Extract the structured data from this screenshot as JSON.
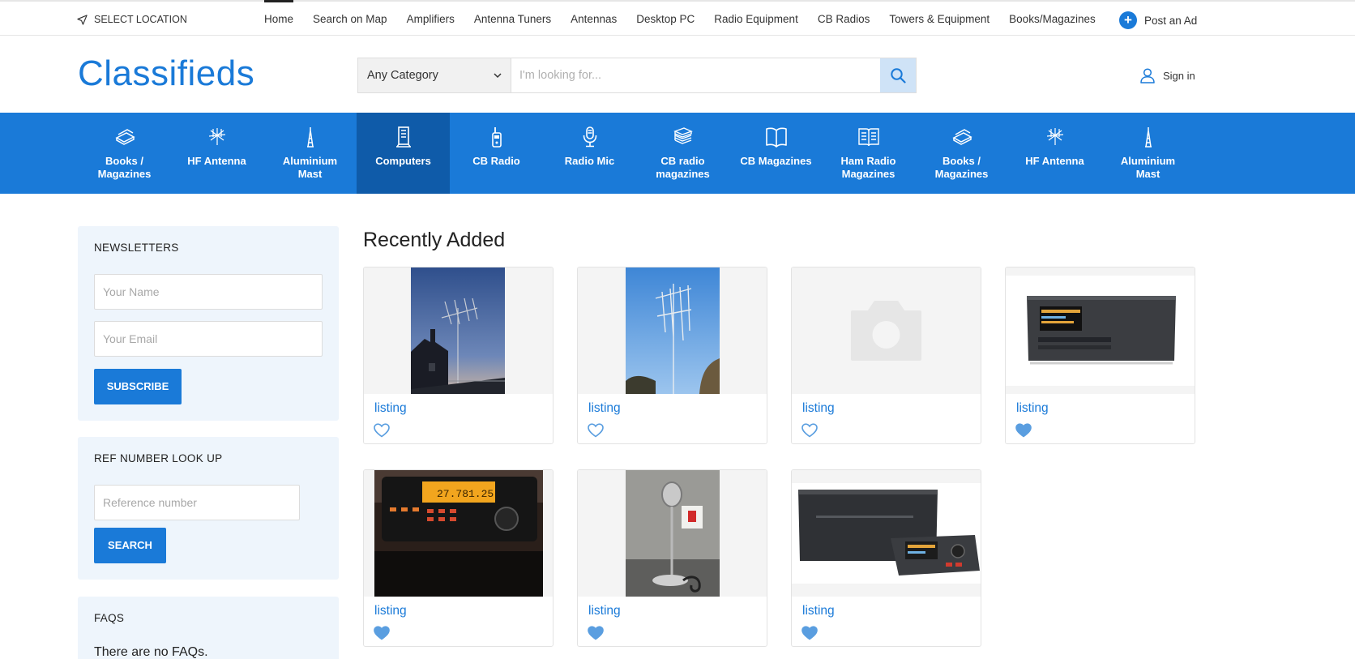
{
  "topbar": {
    "location_label": "SELECT LOCATION",
    "nav": [
      {
        "label": "Home",
        "active": true
      },
      {
        "label": "Search on Map",
        "active": false
      },
      {
        "label": "Amplifiers",
        "active": false
      },
      {
        "label": "Antenna Tuners",
        "active": false
      },
      {
        "label": "Antennas",
        "active": false
      },
      {
        "label": "Desktop PC",
        "active": false
      },
      {
        "label": "Radio Equipment",
        "active": false
      },
      {
        "label": "CB Radios",
        "active": false
      },
      {
        "label": "Towers & Equipment",
        "active": false
      },
      {
        "label": "Books/Magazines",
        "active": false
      }
    ],
    "post_ad_label": "Post an Ad"
  },
  "header": {
    "logo": "Classifieds",
    "category_select": "Any Category",
    "search_placeholder": "I'm looking for...",
    "signin_label": "Sign in"
  },
  "categories": [
    {
      "line1": "Books /",
      "line2": "Magazines",
      "icon": "books-icon",
      "active": false
    },
    {
      "line1": "HF Antenna",
      "line2": "",
      "icon": "antenna-icon",
      "active": false
    },
    {
      "line1": "Aluminium",
      "line2": "Mast",
      "icon": "mast-icon",
      "active": false
    },
    {
      "line1": "Computers",
      "line2": "",
      "icon": "computer-tower-icon",
      "active": true
    },
    {
      "line1": "CB Radio",
      "line2": "",
      "icon": "walkie-talkie-icon",
      "active": false
    },
    {
      "line1": "Radio Mic",
      "line2": "",
      "icon": "microphone-icon",
      "active": false
    },
    {
      "line1": "CB radio",
      "line2": "magazines",
      "icon": "magazine-stack-icon",
      "active": false
    },
    {
      "line1": "CB Magazines",
      "line2": "",
      "icon": "open-book-icon",
      "active": false
    },
    {
      "line1": "Ham Radio",
      "line2": "Magazines",
      "icon": "open-magazine-icon",
      "active": false
    },
    {
      "line1": "Books /",
      "line2": "Magazines",
      "icon": "books-icon",
      "active": false
    },
    {
      "line1": "HF Antenna",
      "line2": "",
      "icon": "antenna-icon",
      "active": false
    },
    {
      "line1": "Aluminium",
      "line2": "Mast",
      "icon": "mast-icon",
      "active": false
    }
  ],
  "sidebar": {
    "newsletter": {
      "title": "NEWSLETTERS",
      "name_placeholder": "Your Name",
      "email_placeholder": "Your Email",
      "button": "SUBSCRIBE"
    },
    "ref_lookup": {
      "title": "REF NUMBER LOOK UP",
      "placeholder": "Reference number",
      "button": "SEARCH"
    },
    "faqs": {
      "title": "FAQS",
      "text": "There are no FAQs."
    }
  },
  "listings": {
    "heading": "Recently Added",
    "items": [
      {
        "title": "listing",
        "image": "antenna-house-photo",
        "favorited": false
      },
      {
        "title": "listing",
        "image": "antenna-sky-photo",
        "favorited": false
      },
      {
        "title": "listing",
        "image": "placeholder-camera",
        "favorited": false
      },
      {
        "title": "listing",
        "image": "amplifier-product-photo",
        "favorited": true
      },
      {
        "title": "listing",
        "image": "transceiver-photo",
        "favorited": true
      },
      {
        "title": "listing",
        "image": "desk-microphone-photo",
        "favorited": true
      },
      {
        "title": "listing",
        "image": "amplifier-with-controller-photo",
        "favorited": true
      }
    ]
  },
  "colors": {
    "brand": "#1a7ad8",
    "brand_dark": "#0f5ba9",
    "panel": "#eef5fc"
  }
}
